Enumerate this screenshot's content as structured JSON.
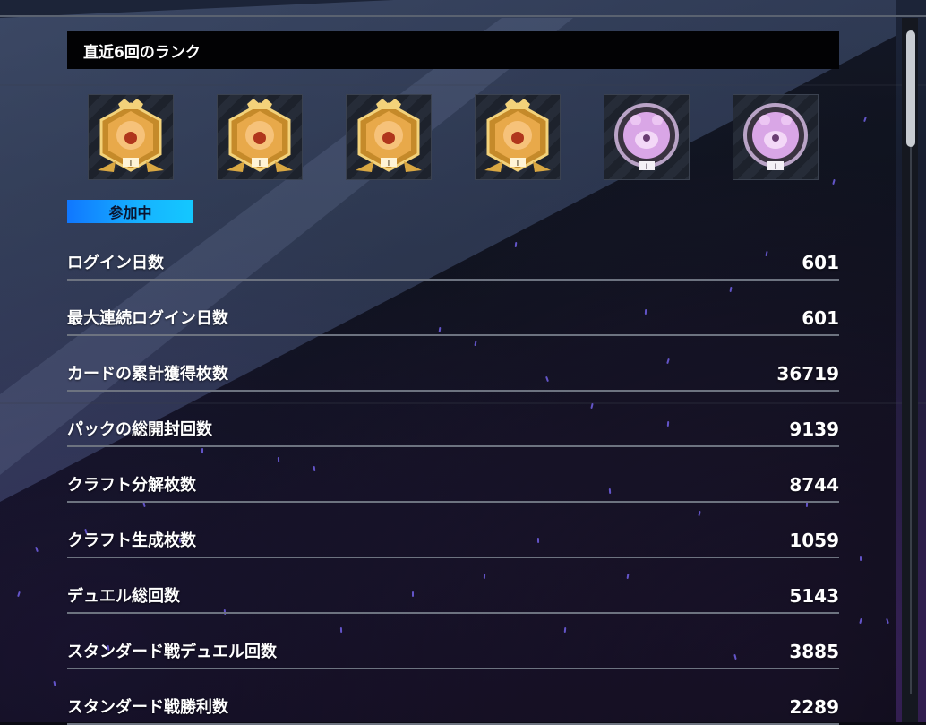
{
  "section_title": "直近6回のランク",
  "badges": [
    {
      "name": "gold-lion-rank-badge",
      "tier": "I"
    },
    {
      "name": "gold-lion-rank-badge",
      "tier": "I"
    },
    {
      "name": "gold-lion-rank-badge",
      "tier": "I"
    },
    {
      "name": "gold-lion-rank-badge",
      "tier": "I"
    },
    {
      "name": "platinum-bear-rank-badge",
      "tier": "I"
    },
    {
      "name": "platinum-bear-rank-badge",
      "tier": "I"
    }
  ],
  "status_badge": "参加中",
  "stats": [
    {
      "label": "ログイン日数",
      "value": "601"
    },
    {
      "label": "最大連続ログイン日数",
      "value": "601"
    },
    {
      "label": "カードの累計獲得枚数",
      "value": "36719"
    },
    {
      "label": "パックの総開封回数",
      "value": "9139"
    },
    {
      "label": "クラフト分解枚数",
      "value": "8744"
    },
    {
      "label": "クラフト生成枚数",
      "value": "1059"
    },
    {
      "label": "デュエル総回数",
      "value": "5143"
    },
    {
      "label": "スタンダード戦デュエル回数",
      "value": "3885"
    },
    {
      "label": "スタンダード戦勝利数",
      "value": "2289"
    }
  ],
  "colors": {
    "accent_blue": "#16b4ff",
    "gold": "#e8a94a",
    "platinum": "#d9a6e6",
    "header_bg": "#020204"
  }
}
